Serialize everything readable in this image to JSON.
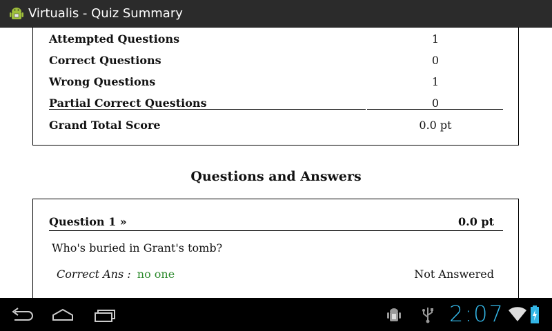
{
  "titlebar": {
    "title": "Virtualis - Quiz Summary",
    "icon": "android-icon"
  },
  "summary": {
    "rows": [
      {
        "label": "Attempted Questions",
        "value": "1"
      },
      {
        "label": "Correct Questions",
        "value": "0"
      },
      {
        "label": "Wrong Questions",
        "value": "1"
      },
      {
        "label": "Partial Correct Questions",
        "value": "0"
      },
      {
        "label": "Grand Total Score",
        "value": "0.0 pt"
      }
    ]
  },
  "qa": {
    "heading": "Questions and Answers",
    "question": {
      "title": "Question 1 »",
      "score": "0.0 pt",
      "text": "Who's buried in Grant's tomb?",
      "answer_label": "Correct Ans :",
      "answer_value": "no one",
      "status": "Not Answered"
    }
  },
  "navbar": {
    "buttons": [
      "back-icon",
      "home-icon",
      "recent-apps-icon"
    ],
    "status_icons": [
      "android-debug-icon",
      "usb-icon",
      "wifi-icon",
      "battery-charging-icon"
    ],
    "clock": "2:07"
  },
  "colors": {
    "accent": "#33b5e5",
    "answer_green": "#2e8b2e",
    "titlebar": "#2b2b2b"
  }
}
